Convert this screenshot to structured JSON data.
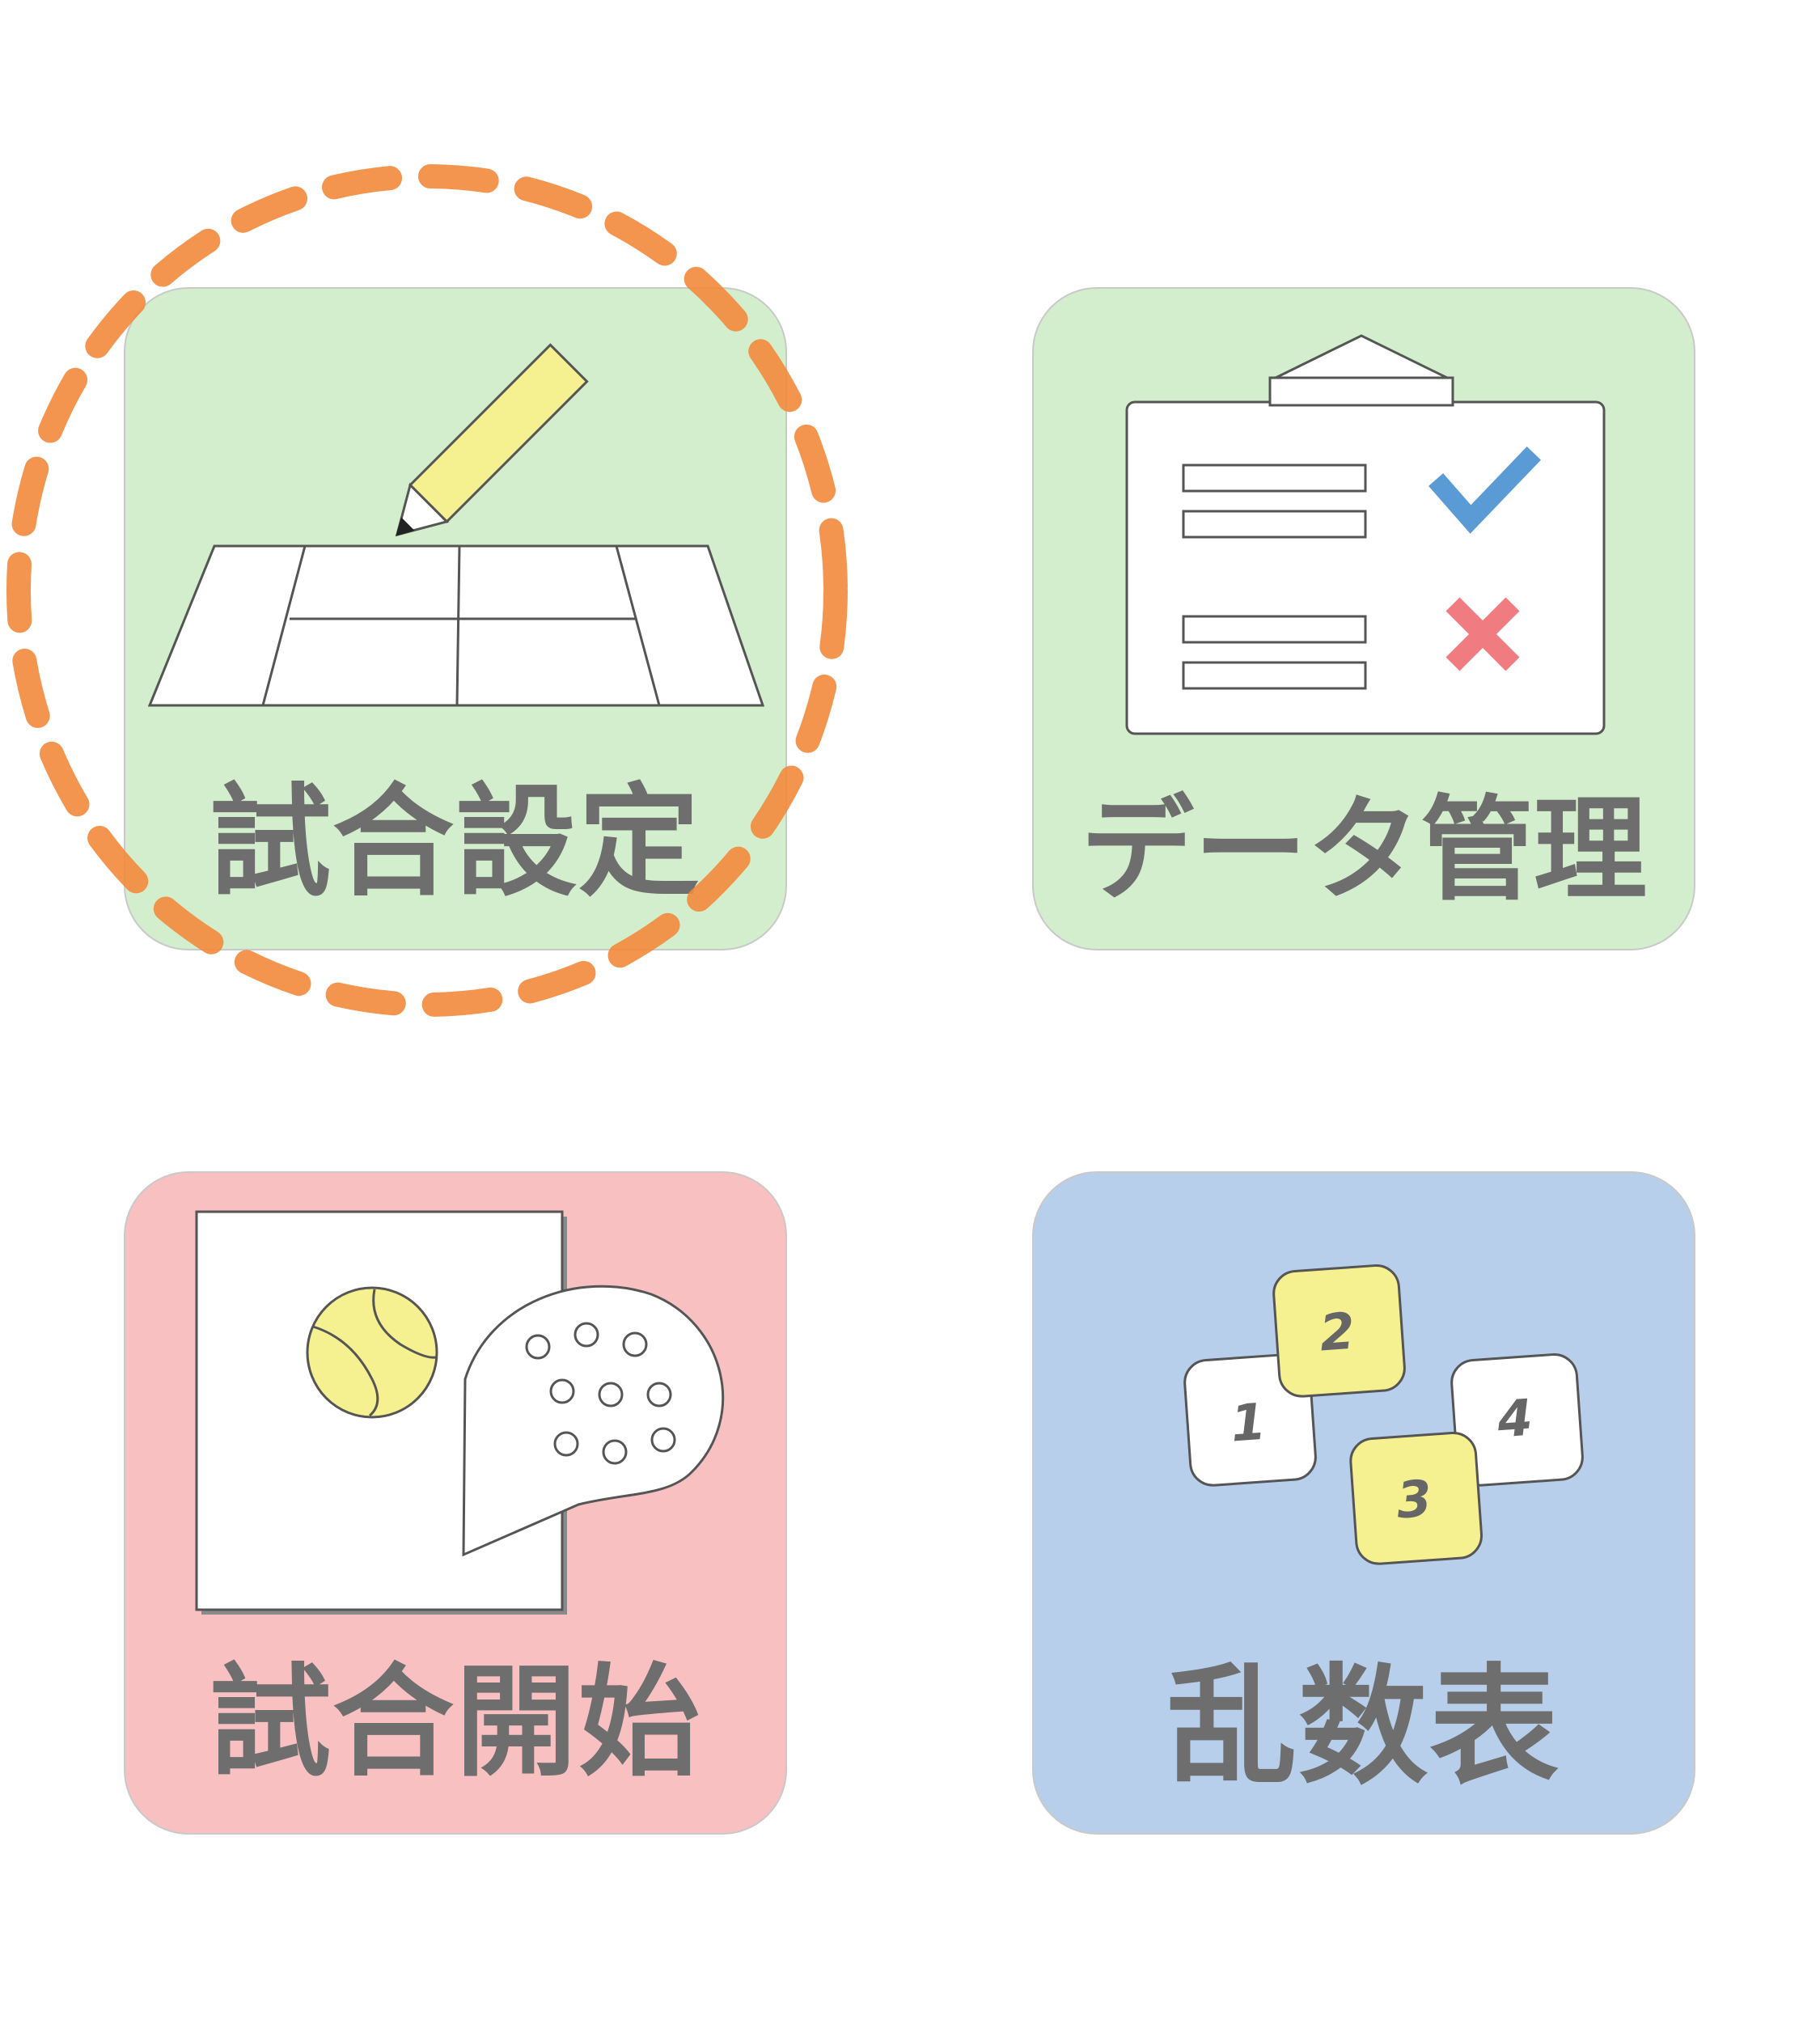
{
  "colors": {
    "green_tile": "#d3eecc",
    "pink_tile": "#f8c0c0",
    "blue_tile": "#b7cfea",
    "label_text": "#6e6e6e",
    "highlight_ring": "#f28a3c",
    "pencil_yellow": "#f5f190",
    "check_blue": "#5b9bd5",
    "cross_red": "#f07b80"
  },
  "menu": {
    "match_settings": {
      "label": "試合設定",
      "icon": "court-pencil-icon"
    },
    "data_management": {
      "label": "データ管理",
      "icon": "clipboard-checklist-icon"
    },
    "match_start": {
      "label": "試合開始",
      "icon": "ball-racket-icon"
    },
    "random_table": {
      "label": "乱数表",
      "icon": "numbered-cards-icon",
      "cards": [
        "1",
        "2",
        "3",
        "4"
      ]
    }
  },
  "highlight": {
    "target": "match_settings",
    "style": "dashed-circle"
  }
}
